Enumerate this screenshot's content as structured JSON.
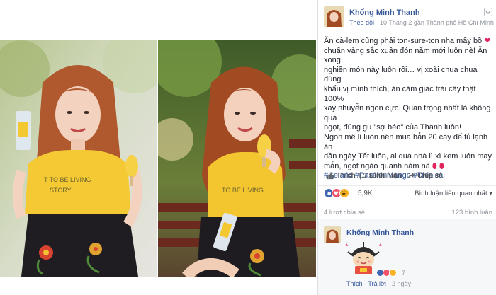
{
  "photos": [
    {
      "alt": "girl with yellow ice cream photo 1"
    },
    {
      "alt": "girl with yellow ice cream photo 2"
    }
  ],
  "post": {
    "author": "Khổng Minh Thanh",
    "follow": "Theo dõi",
    "meta": "· 10 Tháng 2 gần Thành phố Hồ Chí Minh ·",
    "body_lines": [
      "Ăn cà-lem cũng phải ton-sure-ton nha mấy bồ",
      "chuẩn vàng sắc xuân đón năm mới luôn nè! Ăn xong",
      "nghiền món này luôn rồi… vị xoài chua chua đúng",
      "khẩu vị mình thích, ăn cảm giác trái cây thật 100%",
      "xay nhuyễn ngon cực. Quan trọng nhất là không quá",
      "ngọt, đúng gu \"sợ béo\" của Thanh luôn!",
      "Ngon mê lì luôn nên mua hẳn 20 cây để tủ lạnh ăn",
      "dần ngày Tết luôn, ai qua nhà lì xì kem luôn may",
      "mắn, ngọt ngào quanh năm nà"
    ],
    "hashtags": "#Celano #PassionMango #Tropical",
    "heart_color": "#e0245e"
  },
  "actions": {
    "like": "Thích",
    "comment": "Bình luận",
    "share": "Chia sẻ"
  },
  "reactions": {
    "count": "5,9K",
    "relevant": "Bình luận liên quan nhất ▾",
    "shares": "4 lượt chia sẻ",
    "comments": "123 bình luận"
  },
  "comment": {
    "author": "Khổng Minh Thanh",
    "reaction_count": "7",
    "like": "Thích",
    "reply": "Trả lời",
    "time": "2 ngày"
  },
  "colors": {
    "link": "#365899",
    "like_blue": "#4267b2",
    "love_red": "#f25268",
    "haha_yellow": "#f7b125"
  }
}
